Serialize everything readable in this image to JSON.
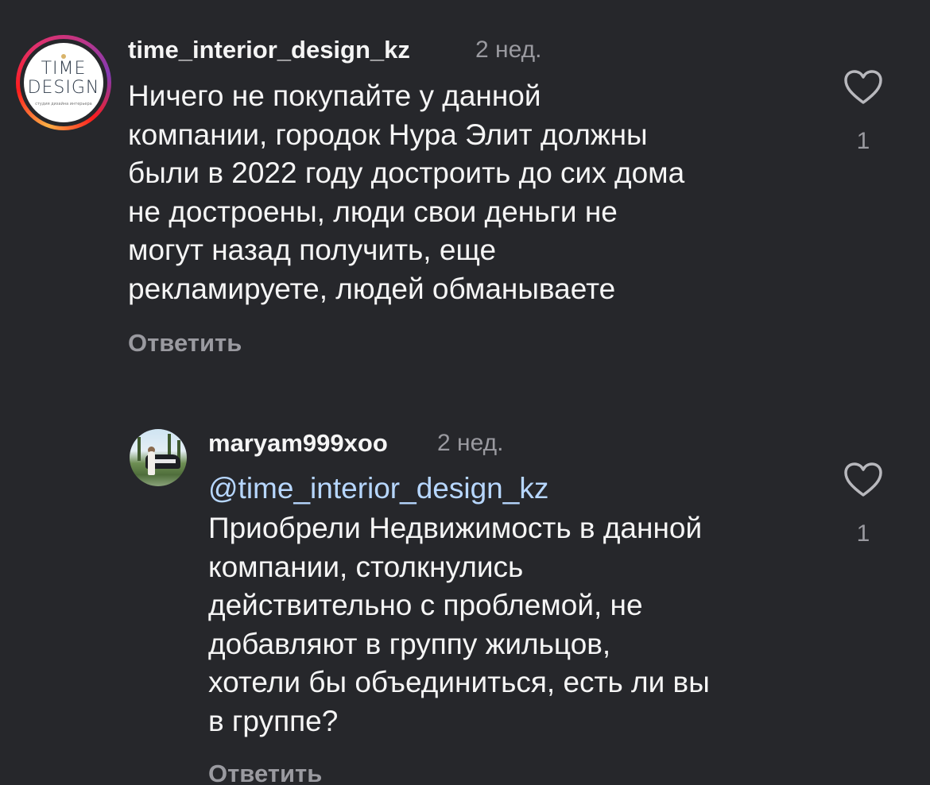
{
  "comments": [
    {
      "username": "time_interior_design_kz",
      "time": "2 нед.",
      "text": "Ничего не покупайте у данной\nкомпании, городок Нура Элит должны\nбыли в 2022 году достроить до сих дома\nне достроены, люди свои деньги не\nмогут назад получить, еще\nрекламируете, людей обманываете",
      "reply_label": "Ответить",
      "likes": "1",
      "avatar": {
        "logo_line1": "TIME",
        "logo_line2": "DESIGN",
        "logo_line3": "студия дизайна интерьера"
      }
    },
    {
      "username": "maryam999xoo",
      "time": "2 нед.",
      "mention": "@time_interior_design_kz",
      "text": "Приобрели Недвижимость в данной\nкомпании, столкнулись\nдействительно с проблемой, не\nдобавляют в группу жильцов,\nхотели бы объединиться, есть ли вы\nв группе?",
      "reply_label": "Ответить",
      "likes": "1"
    }
  ],
  "icons": {
    "like": "heart-outline-icon"
  },
  "colors": {
    "background": "#26272b",
    "text": "#f5f5f5",
    "muted": "#9a9aa0",
    "mention": "#b7d7ff"
  }
}
